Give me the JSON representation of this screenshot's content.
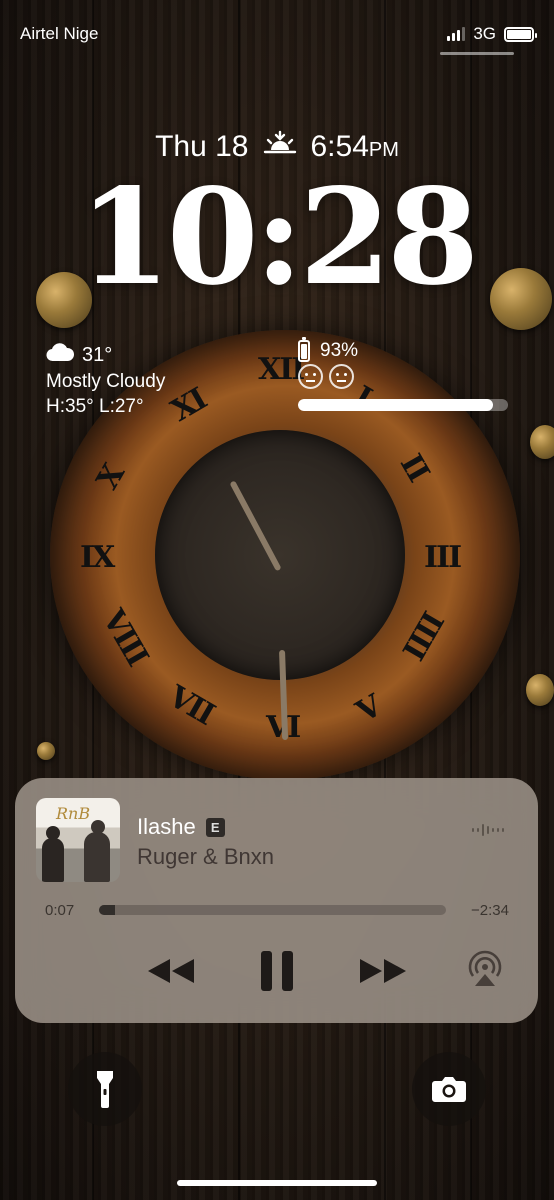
{
  "status_bar": {
    "carrier": "Airtel Nige",
    "network": "3G",
    "signal_bars": 3,
    "battery_level_fraction": 1.0
  },
  "lock_screen": {
    "date": "Thu 18",
    "sunset_icon": "sunset-icon",
    "sunset_time": "6:54",
    "sunset_suffix": "PM",
    "time": "10:28"
  },
  "weather_widget": {
    "icon": "cloud-icon",
    "temperature": "31°",
    "condition": "Mostly Cloudy",
    "high_low": "H:35° L:27°"
  },
  "battery_widget": {
    "icon": "battery-icon",
    "percent": "93%",
    "level_fraction": 0.93,
    "face_icons": [
      "neutral-face-icon",
      "neutral-face-icon"
    ]
  },
  "now_playing": {
    "album_art_text": "RnB",
    "title": "Ilashe",
    "explicit_badge": "E",
    "artist": "Ruger & Bnxn",
    "elapsed": "0:07",
    "remaining": "−2:34",
    "progress_fraction": 0.045,
    "controls": {
      "rewind_icon": "rewind-icon",
      "pause_icon": "pause-icon",
      "forward_icon": "fast-forward-icon",
      "airplay_icon": "airplay-icon",
      "waveform_icon": "waveform-icon"
    }
  },
  "quick_actions": {
    "left_icon": "flashlight-icon",
    "right_icon": "camera-icon"
  },
  "colors": {
    "player_background": "#aaa096",
    "wallpaper_wood": "#221912",
    "clock_rust": "#9a5a22"
  }
}
